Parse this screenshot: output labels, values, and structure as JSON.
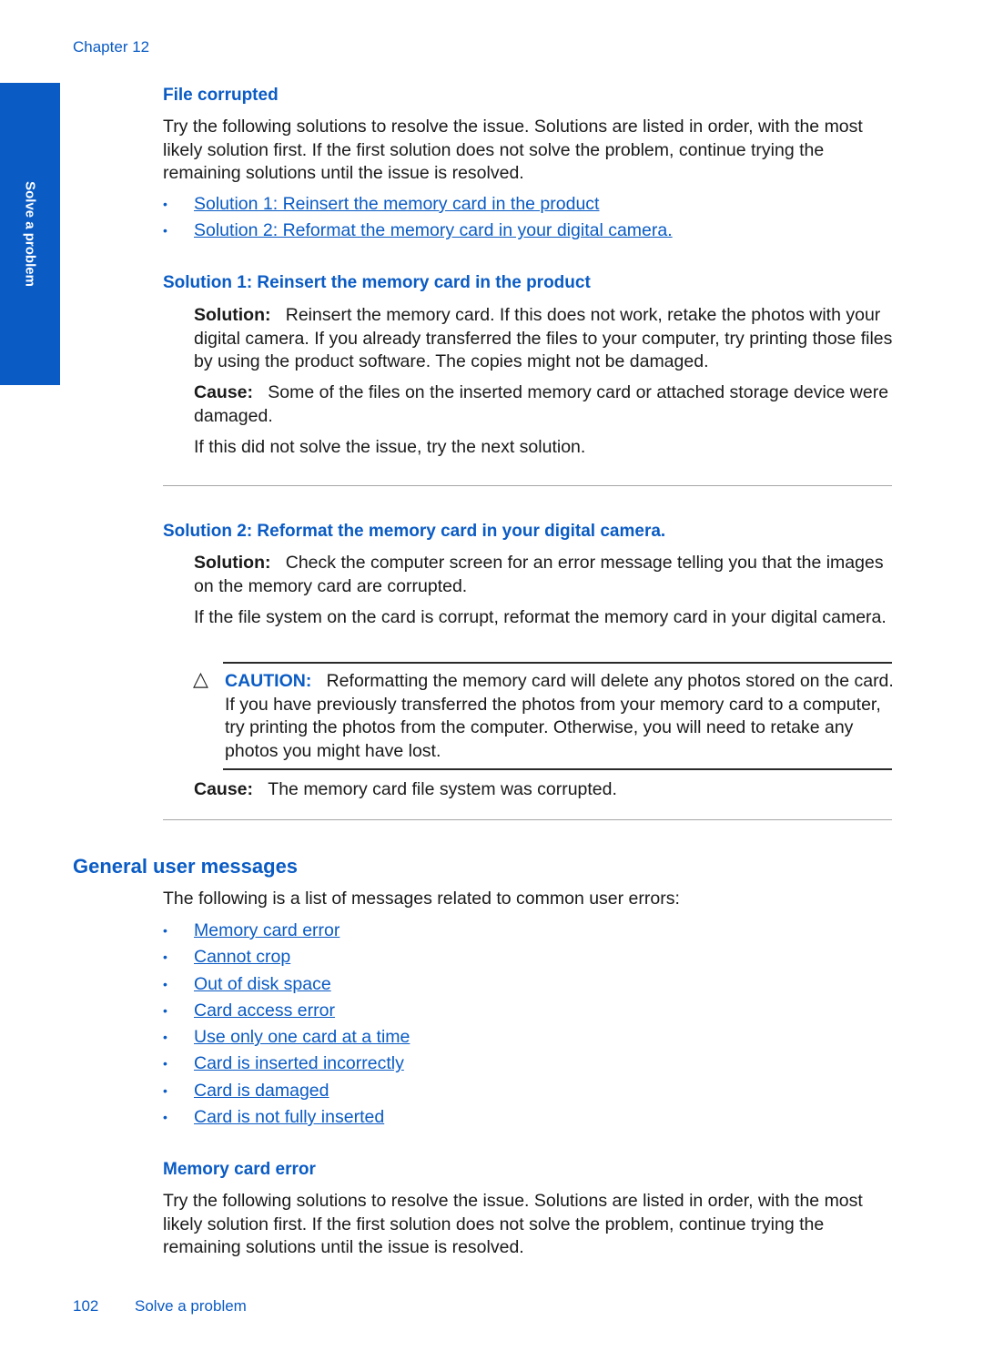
{
  "header": {
    "chapter": "Chapter 12"
  },
  "side_tab": {
    "label": "Solve a problem"
  },
  "file_corrupted": {
    "title": "File corrupted",
    "intro": "Try the following solutions to resolve the issue. Solutions are listed in order, with the most likely solution first. If the first solution does not solve the problem, continue trying the remaining solutions until the issue is resolved.",
    "links": [
      "Solution 1: Reinsert the memory card in the product",
      "Solution 2: Reformat the memory card in your digital camera."
    ],
    "solution1": {
      "title": "Solution 1: Reinsert the memory card in the product",
      "solution_label": "Solution:",
      "solution_text": "Reinsert the memory card. If this does not work, retake the photos with your digital camera. If you already transferred the files to your computer, try printing those files by using the product software. The copies might not be damaged.",
      "cause_label": "Cause:",
      "cause_text": "Some of the files on the inserted memory card or attached storage device were damaged.",
      "next": "If this did not solve the issue, try the next solution."
    },
    "solution2": {
      "title": "Solution 2: Reformat the memory card in your digital camera.",
      "solution_label": "Solution:",
      "solution_text": "Check the computer screen for an error message telling you that the images on the memory card are corrupted.",
      "extra": "If the file system on the card is corrupt, reformat the memory card in your digital camera.",
      "caution_label": "CAUTION:",
      "caution_text": "Reformatting the memory card will delete any photos stored on the card. If you have previously transferred the photos from your memory card to a computer, try printing the photos from the computer. Otherwise, you will need to retake any photos you might have lost.",
      "cause_label": "Cause:",
      "cause_text": "The memory card file system was corrupted."
    }
  },
  "general_messages": {
    "title": "General user messages",
    "intro": "The following is a list of messages related to common user errors:",
    "links": [
      "Memory card error",
      "Cannot crop",
      "Out of disk space",
      "Card access error",
      "Use only one card at a time",
      "Card is inserted incorrectly",
      "Card is damaged",
      "Card is not fully inserted"
    ]
  },
  "memory_card_error": {
    "title": "Memory card error",
    "intro": "Try the following solutions to resolve the issue. Solutions are listed in order, with the most likely solution first. If the first solution does not solve the problem, continue trying the remaining solutions until the issue is resolved."
  },
  "footer": {
    "page_number": "102",
    "section": "Solve a problem"
  },
  "icons": {
    "bullet": "•",
    "caution": "△"
  }
}
